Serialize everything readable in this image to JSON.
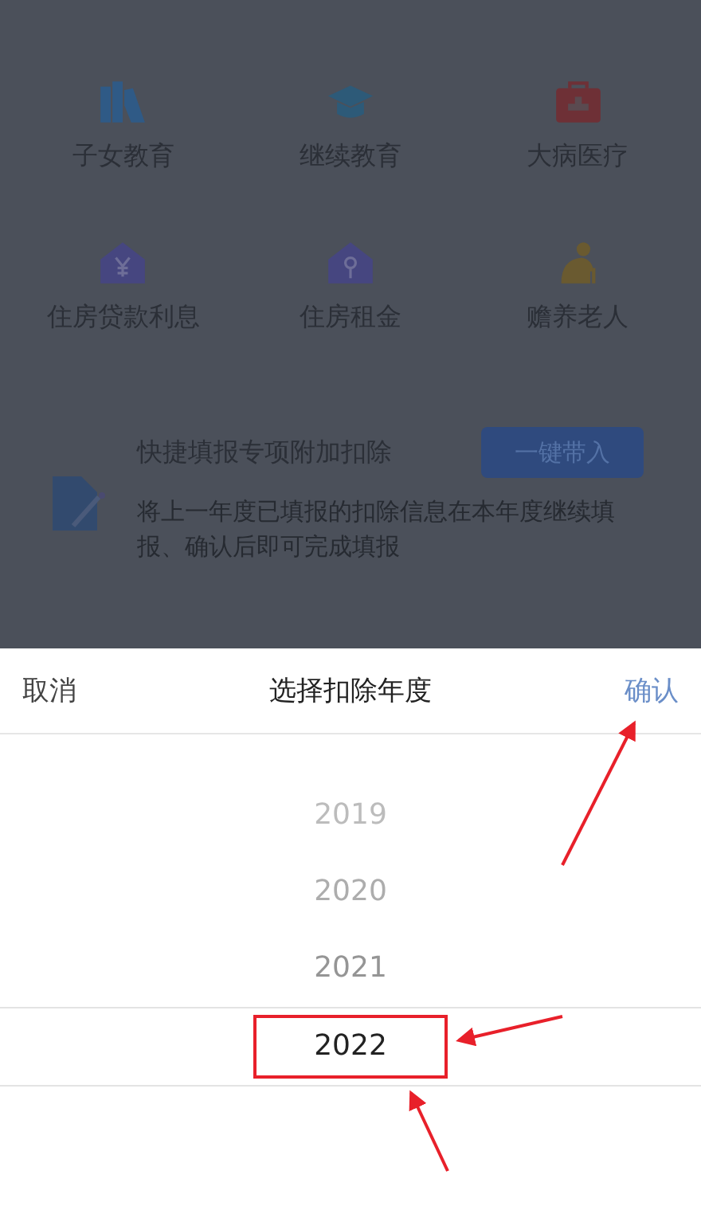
{
  "background": {
    "categories": [
      {
        "label": "子女教育",
        "kind": "books"
      },
      {
        "label": "继续教育",
        "kind": "cap"
      },
      {
        "label": "大病医疗",
        "kind": "medkit"
      },
      {
        "label": "住房贷款利息",
        "kind": "house-yen"
      },
      {
        "label": "住房租金",
        "kind": "house-key"
      },
      {
        "label": "赡养老人",
        "kind": "elder"
      }
    ],
    "quick_fill": {
      "title": "快捷填报专项附加扣除",
      "button": "一键带入",
      "description": "将上一年度已填报的扣除信息在本年度继续填报、确认后即可完成填报"
    }
  },
  "picker": {
    "cancel": "取消",
    "title": "选择扣除年度",
    "confirm": "确认",
    "years": [
      {
        "label": "2019",
        "selected": false
      },
      {
        "label": "2020",
        "selected": false
      },
      {
        "label": "2021",
        "selected": false
      },
      {
        "label": "2022",
        "selected": true
      }
    ]
  }
}
